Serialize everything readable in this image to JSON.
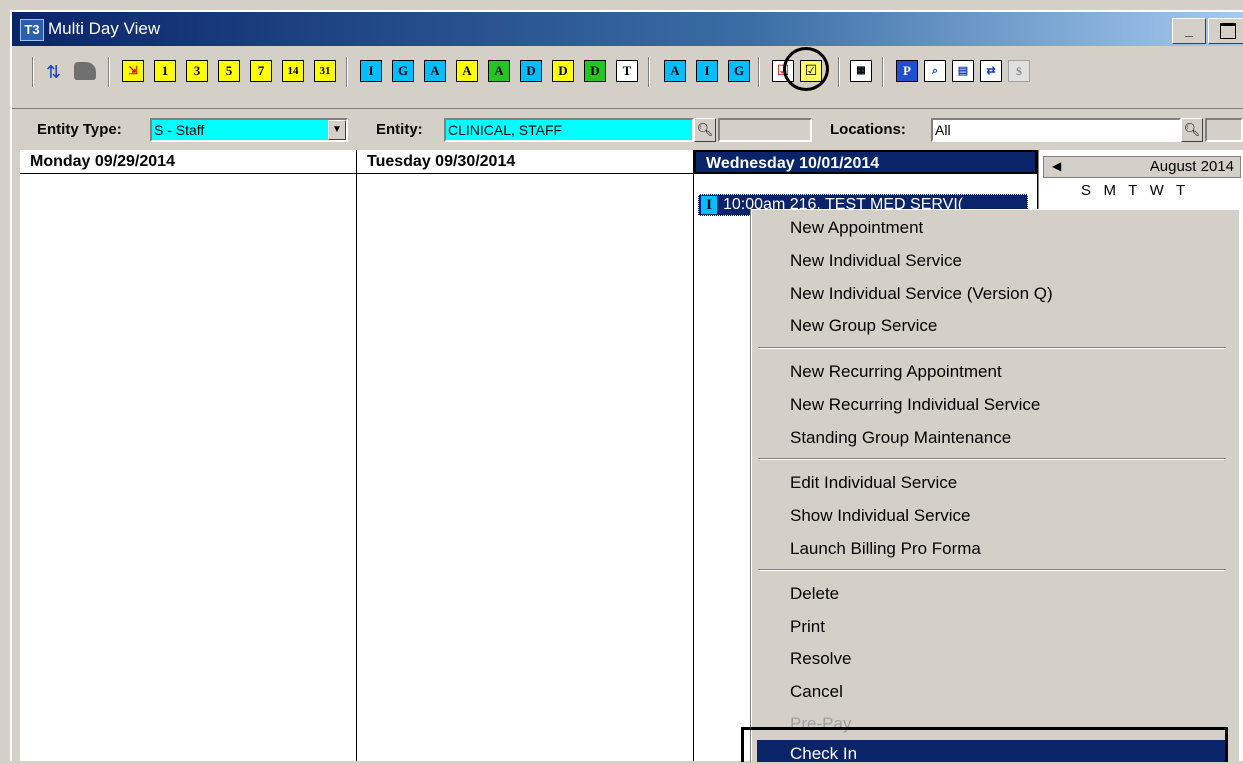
{
  "window": {
    "title": "Multi Day View",
    "app_icon": "T3",
    "minimize_label": "_"
  },
  "toolbar": {
    "buttons": [
      "14",
      "31",
      "I",
      "G",
      "A",
      "A",
      "A",
      "D",
      "D",
      "D",
      "T",
      "A",
      "I",
      "G",
      "P"
    ],
    "small_days": [
      "1",
      "3",
      "5",
      "7"
    ]
  },
  "filter": {
    "entity_type_label": "Entity Type:",
    "entity_type_value": "S - Staff",
    "entity_label": "Entity:",
    "entity_value": "CLINICAL, STAFF",
    "locations_label": "Locations:",
    "locations_value": "All"
  },
  "days": [
    {
      "header": "Monday 09/29/2014"
    },
    {
      "header": "Tuesday 09/30/2014"
    },
    {
      "header": "Wednesday 10/01/2014"
    }
  ],
  "appointment": {
    "type": "I",
    "text": "10:00am 216, TEST MED SERVI("
  },
  "mini_calendar": {
    "month": "August 2014",
    "weekdays": "S   M   T   W   T"
  },
  "context_menu": {
    "groups": [
      [
        "New Appointment",
        "New Individual Service",
        "New Individual Service (Version Q)",
        "New Group Service"
      ],
      [
        "New Recurring Appointment",
        "New Recurring Individual Service",
        "Standing Group Maintenance"
      ],
      [
        "Edit Individual Service",
        "Show Individual Service",
        "Launch Billing Pro Forma"
      ],
      [
        "Delete",
        "Print",
        "Resolve",
        "Cancel",
        "Pre-Pay",
        "Check In"
      ]
    ]
  },
  "colors": {
    "title_gradient_start": "#0a246a",
    "highlight": "#0a246a",
    "field_cyan": "#00ffff",
    "disabled_text": "#a0a0a0"
  }
}
